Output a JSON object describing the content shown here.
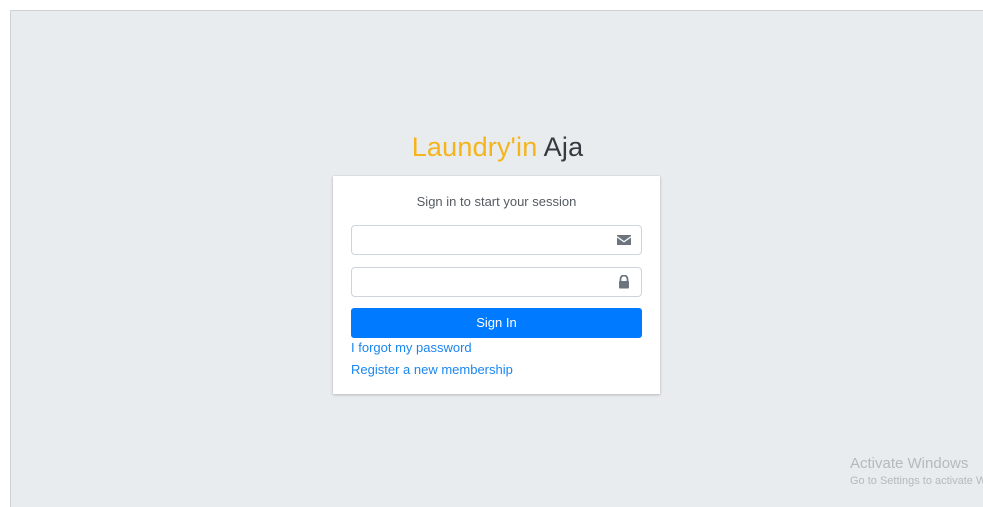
{
  "logo": {
    "brand": "Laundry'in",
    "rest": "Aja"
  },
  "login_box": {
    "message": "Sign in to start your session",
    "email_field": {
      "value": "",
      "placeholder": "",
      "icon": "envelope-icon"
    },
    "password_field": {
      "value": "",
      "placeholder": "",
      "icon": "lock-icon"
    },
    "sign_in_label": "Sign In",
    "forgot_password_link": "I forgot my password",
    "register_link": "Register a new membership"
  },
  "watermark": {
    "title": "Activate Windows",
    "subtitle": "Go to Settings to activate Windows."
  },
  "colors": {
    "background": "#e9ecef",
    "brand": "#f4b41a",
    "primary": "#007bff",
    "link": "#1a86f0"
  }
}
